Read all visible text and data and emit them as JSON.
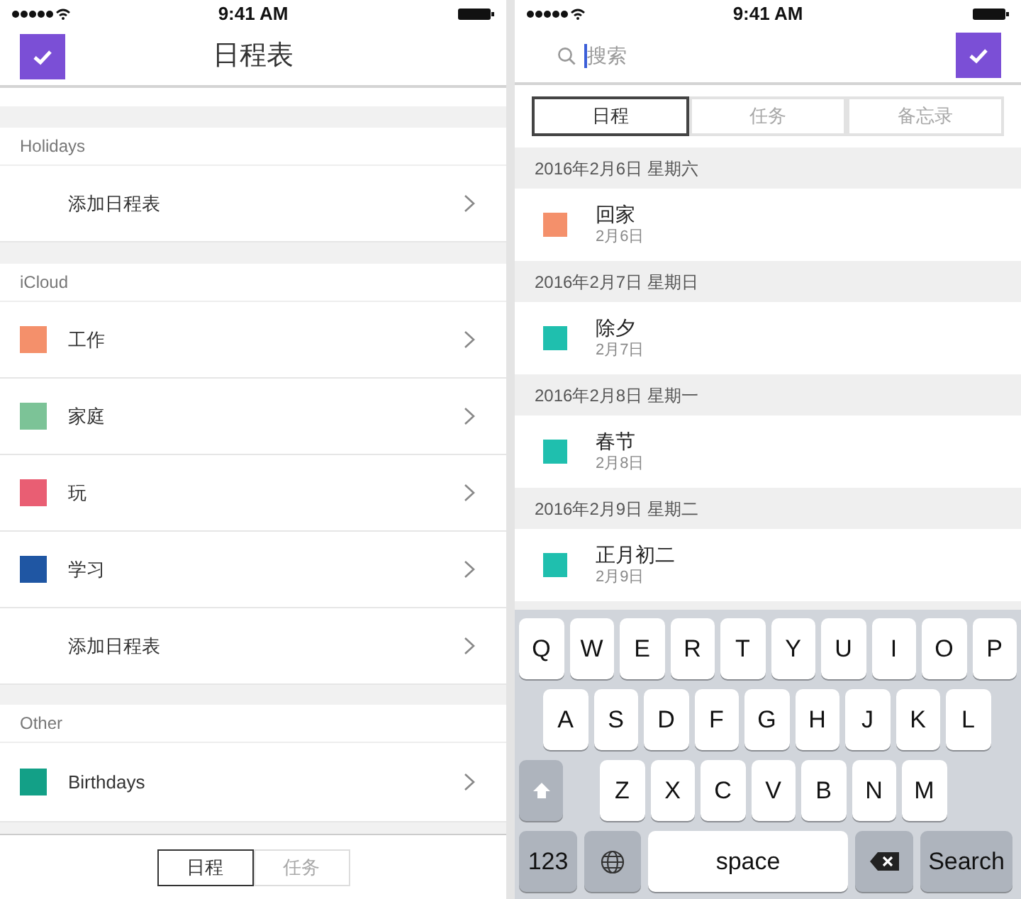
{
  "left": {
    "status_bar": {
      "time": "9:41 AM"
    },
    "title": "日程表",
    "sections": [
      {
        "header": "Holidays",
        "items": [
          {
            "kind": "add",
            "label": "添加日程表"
          }
        ]
      },
      {
        "header": "iCloud",
        "items": [
          {
            "kind": "calendar",
            "label": "工作",
            "color": "#f4906b"
          },
          {
            "kind": "calendar",
            "label": "家庭",
            "color": "#7cc397"
          },
          {
            "kind": "calendar",
            "label": "玩",
            "color": "#e95e73"
          },
          {
            "kind": "calendar",
            "label": "学习",
            "color": "#1f56a3"
          },
          {
            "kind": "add",
            "label": "添加日程表"
          }
        ]
      },
      {
        "header": "Other",
        "items": [
          {
            "kind": "calendar",
            "label": "Birthdays",
            "color": "#13a087"
          }
        ]
      }
    ],
    "bottom_tabs": [
      {
        "label": "日程",
        "selected": true
      },
      {
        "label": "任务",
        "selected": false
      }
    ]
  },
  "right": {
    "status_bar": {
      "time": "9:41 AM"
    },
    "search": {
      "placeholder": "搜索"
    },
    "segments": [
      {
        "label": "日程",
        "selected": true
      },
      {
        "label": "任务",
        "selected": false
      },
      {
        "label": "备忘录",
        "selected": false
      }
    ],
    "events": [
      {
        "date": "2016年2月6日 星期六",
        "title": "回家",
        "subtitle": "2月6日",
        "color": "#f4906b"
      },
      {
        "date": "2016年2月7日 星期日",
        "title": "除夕",
        "subtitle": "2月7日",
        "color": "#1fbfae"
      },
      {
        "date": "2016年2月8日 星期一",
        "title": "春节",
        "subtitle": "2月8日",
        "color": "#1fbfae"
      },
      {
        "date": "2016年2月9日 星期二",
        "title": "正月初二",
        "subtitle": "2月9日",
        "color": "#1fbfae"
      }
    ],
    "keyboard": {
      "rows": [
        [
          "Q",
          "W",
          "E",
          "R",
          "T",
          "Y",
          "U",
          "I",
          "O",
          "P"
        ],
        [
          "A",
          "S",
          "D",
          "F",
          "G",
          "H",
          "J",
          "K",
          "L"
        ],
        [
          "Z",
          "X",
          "C",
          "V",
          "B",
          "N",
          "M"
        ]
      ],
      "number_key": "123",
      "space_key": "space",
      "action_key": "Search"
    }
  }
}
